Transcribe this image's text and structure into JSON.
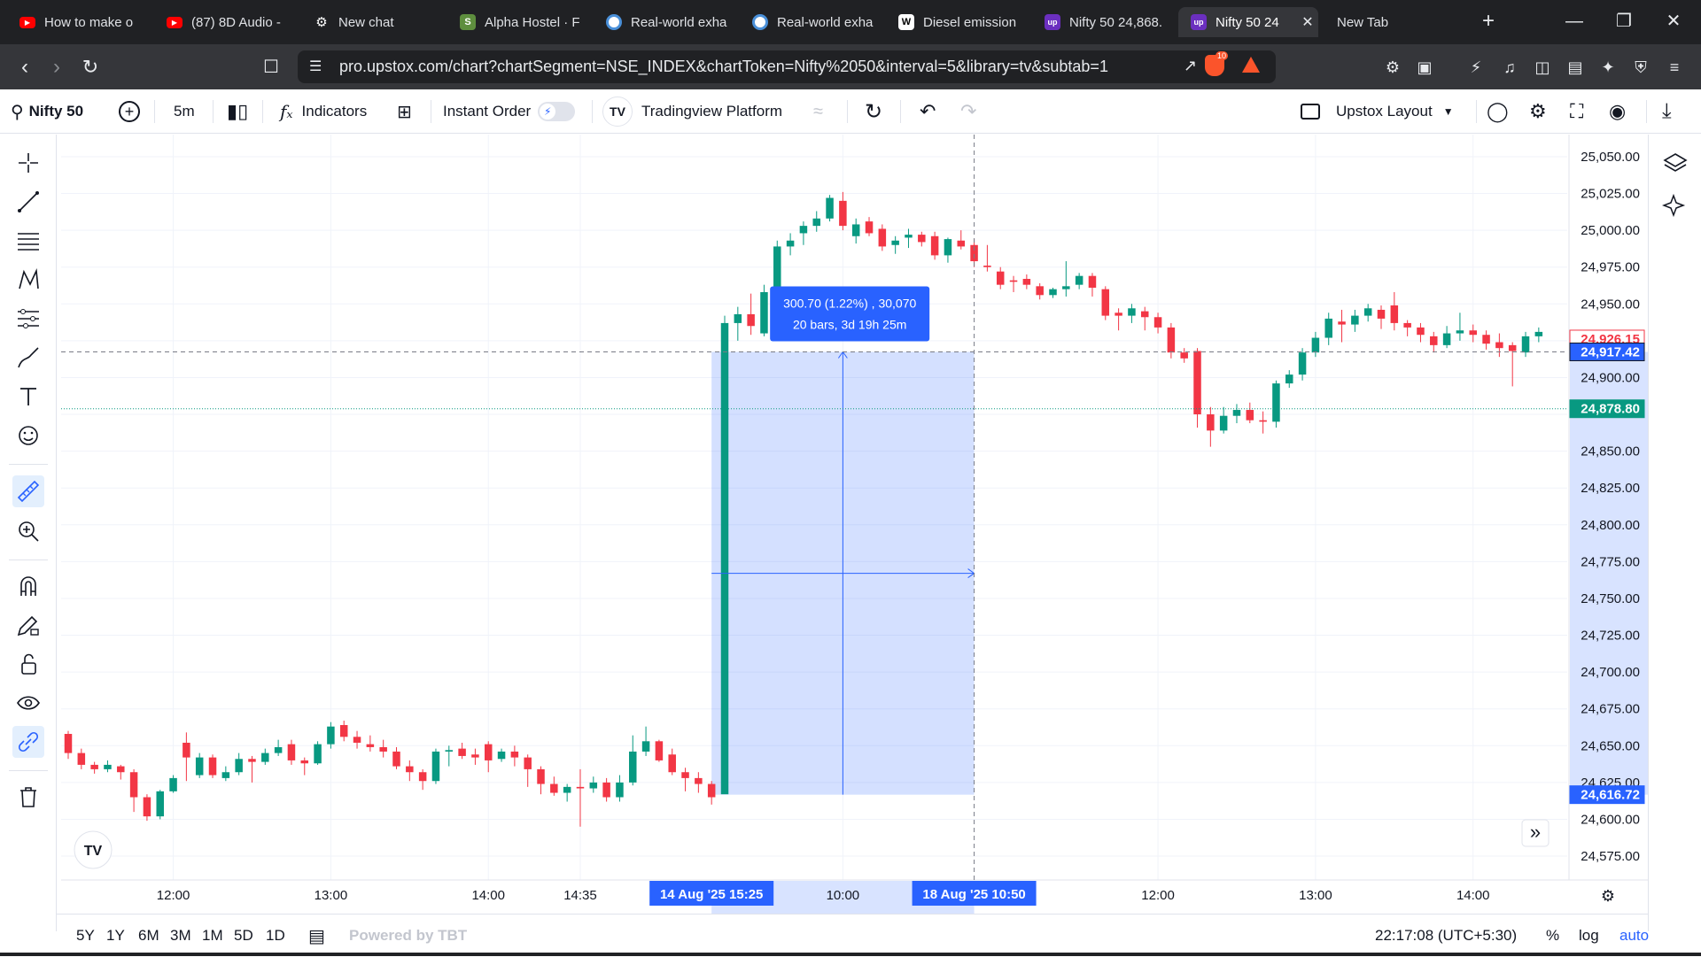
{
  "tabs": [
    {
      "title": "How to make o",
      "favicon": "youtube-icon",
      "color": "#ff0000"
    },
    {
      "title": "(87) 8D Audio -",
      "favicon": "youtube-icon",
      "color": "#ff0000"
    },
    {
      "title": "New chat",
      "favicon": "openai-icon",
      "color": "#5f6368"
    },
    {
      "title": "Alpha Hostel · F",
      "favicon": "shopify-icon",
      "color": "#5e8e3e"
    },
    {
      "title": "Real-world exha",
      "favicon": "circle-icon",
      "color": "#ffffff"
    },
    {
      "title": "Real-world exha",
      "favicon": "circle-icon",
      "color": "#ffffff"
    },
    {
      "title": "Diesel emission",
      "favicon": "wikipedia-icon",
      "color": "#ffffff"
    },
    {
      "title": "Nifty 50 24,868.",
      "favicon": "upstox-icon",
      "color": "#6b2fbf"
    },
    {
      "title": "Nifty 50 24",
      "favicon": "upstox-icon",
      "color": "#6b2fbf",
      "active": true
    },
    {
      "title": "New Tab",
      "favicon": "",
      "color": ""
    }
  ],
  "browser": {
    "url": "pro.upstox.com/chart?chartSegment=NSE_INDEX&chartToken=Nifty%2050&interval=5&library=tv&subtab=1",
    "brave_badge": "10"
  },
  "toolbar": {
    "symbol": "Nifty 50",
    "interval": "5m",
    "indicators": "Indicators",
    "instant_order": "Instant Order",
    "platform": "Tradingview Platform",
    "layout": "Upstox Layout"
  },
  "bottombar": {
    "ranges": [
      "5Y",
      "1Y",
      "6M",
      "3M",
      "1M",
      "5D",
      "1D"
    ],
    "powered_by": "Powered by TBT",
    "time": "22:17:08 (UTC+5:30)",
    "percent": "%",
    "log": "log",
    "auto": "auto"
  },
  "chart_data": {
    "type": "candlestick",
    "symbol": "Nifty 50",
    "interval": "5m",
    "y_ticks": [
      25050,
      25025,
      25000,
      24975,
      24950,
      24925,
      24900,
      24875,
      24850,
      24825,
      24800,
      24775,
      24750,
      24725,
      24700,
      24675,
      24650,
      24625,
      24600,
      24575
    ],
    "y_tick_labels": [
      "25,050.00",
      "25,025.00",
      "25,000.00",
      "24,975.00",
      "24,950.00",
      "",
      "24,900.00",
      "",
      "24,850.00",
      "24,825.00",
      "24,800.00",
      "24,775.00",
      "24,750.00",
      "24,725.00",
      "24,700.00",
      "24,675.00",
      "24,650.00",
      "24,625.00",
      "24,600.00",
      "24,575.00"
    ],
    "ylim": [
      24560,
      25065
    ],
    "x_tick_labels": [
      {
        "label": "12:00",
        "bar": 8
      },
      {
        "label": "13:00",
        "bar": 20
      },
      {
        "label": "14:00",
        "bar": 32
      },
      {
        "label": "14:35",
        "bar": 39
      },
      {
        "label": "10:00",
        "bar": 59
      },
      {
        "label": "12:00",
        "bar": 83
      },
      {
        "label": "13:00",
        "bar": 95
      },
      {
        "label": "14:00",
        "bar": 107
      }
    ],
    "date_labels": [
      {
        "label": "14 Aug '25  15:25",
        "bar": 49
      },
      {
        "label": "18 Aug '25  10:50",
        "bar": 69
      }
    ],
    "price_labels": {
      "last_close": "24,926.15",
      "crosshair": "24,917.42",
      "green_line": "24,878.80",
      "measure_low": "24,616.72"
    },
    "price_lines": {
      "crosshair": 24917.42,
      "green_line": 24878.8
    },
    "measure": {
      "start_bar": 49,
      "end_bar": 69,
      "low": 24616.72,
      "high": 24917.42,
      "line1": "300.70 (1.22%) , 30,070",
      "line2": "20 bars, 3d 19h 25m"
    },
    "colors": {
      "up": "#089981",
      "down": "#f23645",
      "measure": "#2962ff",
      "green_line": "#089981"
    },
    "candles": [
      [
        24658,
        24660,
        24641,
        24645
      ],
      [
        24645,
        24648,
        24634,
        24637
      ],
      [
        24637,
        24639,
        24631,
        24634
      ],
      [
        24634,
        24640,
        24632,
        24637
      ],
      [
        24636,
        24637,
        24627,
        24632
      ],
      [
        24632,
        24634,
        24605,
        24615
      ],
      [
        24615,
        24617,
        24599,
        24602
      ],
      [
        24602,
        24620,
        24600,
        24619
      ],
      [
        24619,
        24630,
        24618,
        24628
      ],
      [
        24652,
        24659,
        24626,
        24642
      ],
      [
        24630,
        24645,
        24628,
        24642
      ],
      [
        24642,
        24644,
        24628,
        24630
      ],
      [
        24628,
        24636,
        24626,
        24632
      ],
      [
        24632,
        24645,
        24630,
        24641
      ],
      [
        24641,
        24643,
        24625,
        24639
      ],
      [
        24639,
        24648,
        24637,
        24645
      ],
      [
        24645,
        24654,
        24643,
        24649
      ],
      [
        24651,
        24654,
        24637,
        24640
      ],
      [
        24640,
        24642,
        24630,
        24638
      ],
      [
        24638,
        24653,
        24637,
        24651
      ],
      [
        24651,
        24666,
        24648,
        24663
      ],
      [
        24664,
        24667,
        24653,
        24656
      ],
      [
        24656,
        24660,
        24648,
        24652
      ],
      [
        24651,
        24657,
        24646,
        24649
      ],
      [
        24649,
        24654,
        24642,
        24646
      ],
      [
        24646,
        24649,
        24634,
        24636
      ],
      [
        24636,
        24640,
        24626,
        24632
      ],
      [
        24632,
        24634,
        24620,
        24626
      ],
      [
        24626,
        24648,
        24624,
        24646
      ],
      [
        24646,
        24650,
        24636,
        24647
      ],
      [
        24648,
        24652,
        24641,
        24643
      ],
      [
        24644,
        24648,
        24637,
        24642
      ],
      [
        24651,
        24653,
        24632,
        24640
      ],
      [
        24641,
        24648,
        24639,
        24646
      ],
      [
        24646,
        24650,
        24636,
        24642
      ],
      [
        24642,
        24644,
        24622,
        24634
      ],
      [
        24634,
        24636,
        24617,
        24624
      ],
      [
        24624,
        24629,
        24616,
        24618
      ],
      [
        24618,
        24624,
        24612,
        24622
      ],
      [
        24622,
        24634,
        24595,
        24621
      ],
      [
        24621,
        24629,
        24618,
        24625
      ],
      [
        24625,
        24628,
        24612,
        24615
      ],
      [
        24615,
        24630,
        24612,
        24625
      ],
      [
        24625,
        24657,
        24623,
        24646
      ],
      [
        24646,
        24663,
        24643,
        24653
      ],
      [
        24653,
        24654,
        24639,
        24640
      ],
      [
        24644,
        24648,
        24630,
        24632
      ],
      [
        24632,
        24635,
        24619,
        24628
      ],
      [
        24628,
        24632,
        24618,
        24624
      ],
      [
        24624,
        24626,
        24610,
        24615
      ],
      [
        24617,
        24942,
        24880,
        24937
      ],
      [
        24937,
        24948,
        24925,
        24943
      ],
      [
        24943,
        24957,
        24929,
        24935
      ],
      [
        24930,
        24963,
        24928,
        24958
      ],
      [
        24958,
        24993,
        24955,
        24989
      ],
      [
        24989,
        24998,
        24983,
        24993
      ],
      [
        24998,
        25006,
        24990,
        25003
      ],
      [
        25003,
        25013,
        24999,
        25008
      ],
      [
        25008,
        25024,
        25006,
        25022
      ],
      [
        25020,
        25026,
        25000,
        25003
      ],
      [
        24996,
        25008,
        24991,
        25004
      ],
      [
        25006,
        25009,
        24996,
        24998
      ],
      [
        25001,
        25004,
        24986,
        24989
      ],
      [
        24990,
        24996,
        24984,
        24993
      ],
      [
        24995,
        25001,
        24988,
        24997
      ],
      [
        24997,
        24999,
        24989,
        24992
      ],
      [
        24996,
        24999,
        24980,
        24983
      ],
      [
        24983,
        24995,
        24978,
        24994
      ],
      [
        24993,
        25000,
        24987,
        24989
      ],
      [
        24990,
        24994,
        24975,
        24979
      ],
      [
        24976,
        24990,
        24972,
        24975
      ],
      [
        24972,
        24975,
        24960,
        24963
      ],
      [
        24966,
        24969,
        24958,
        24965
      ],
      [
        24967,
        24970,
        24960,
        24963
      ],
      [
        24962,
        24964,
        24953,
        24956
      ],
      [
        24956,
        24961,
        24954,
        24960
      ],
      [
        24960,
        24979,
        24955,
        24962
      ],
      [
        24963,
        24971,
        24960,
        24969
      ],
      [
        24969,
        24971,
        24955,
        24961
      ],
      [
        24960,
        24962,
        24939,
        24942
      ],
      [
        24944,
        24947,
        24932,
        24942
      ],
      [
        24942,
        24950,
        24937,
        24947
      ],
      [
        24945,
        24948,
        24932,
        24941
      ],
      [
        24941,
        24944,
        24930,
        24934
      ],
      [
        24934,
        24937,
        24913,
        24917
      ],
      [
        24917,
        24920,
        24910,
        24913
      ],
      [
        24918,
        24920,
        24866,
        24875
      ],
      [
        24875,
        24880,
        24853,
        24864
      ],
      [
        24864,
        24880,
        24862,
        24874
      ],
      [
        24874,
        24882,
        24869,
        24878
      ],
      [
        24878,
        24883,
        24869,
        24871
      ],
      [
        24871,
        24877,
        24862,
        24870
      ],
      [
        24870,
        24898,
        24866,
        24896
      ],
      [
        24896,
        24905,
        24893,
        24902
      ],
      [
        24902,
        24920,
        24898,
        24917
      ],
      [
        24917,
        24931,
        24914,
        24927
      ],
      [
        24927,
        24944,
        24922,
        24940
      ],
      [
        24938,
        24946,
        24924,
        24936
      ],
      [
        24936,
        24946,
        24931,
        24942
      ],
      [
        24942,
        24950,
        24938,
        24947
      ],
      [
        24946,
        24949,
        24933,
        24940
      ],
      [
        24949,
        24958,
        24932,
        24937
      ],
      [
        24937,
        24939,
        24928,
        24934
      ],
      [
        24934,
        24937,
        24924,
        24929
      ],
      [
        24928,
        24931,
        24917,
        24922
      ],
      [
        24922,
        24935,
        24920,
        24930
      ],
      [
        24930,
        24944,
        24925,
        24932
      ],
      [
        24932,
        24936,
        24924,
        24929
      ],
      [
        24929,
        24932,
        24919,
        24923
      ],
      [
        24924,
        24930,
        24914,
        24920
      ],
      [
        24922,
        24924,
        24894,
        24918
      ],
      [
        24917,
        24931,
        24914,
        24928
      ],
      [
        24928,
        24934,
        24924,
        24931
      ]
    ]
  }
}
